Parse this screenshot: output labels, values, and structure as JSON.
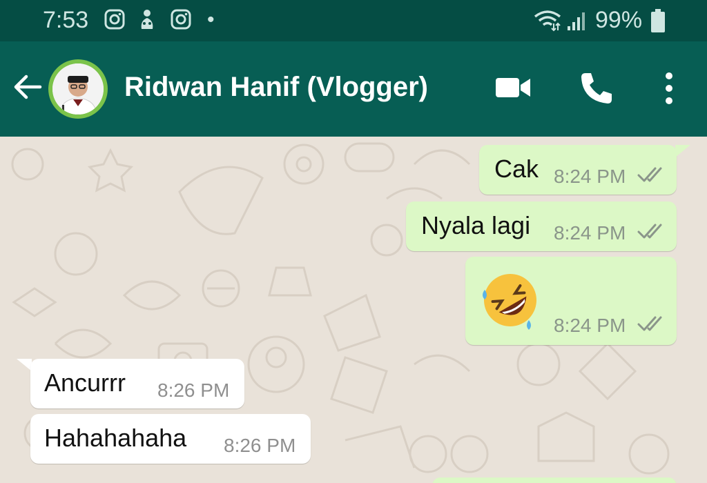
{
  "status_bar": {
    "time": "7:53",
    "battery": "99%",
    "icons": [
      "instagram-icon",
      "notification-icon",
      "instagram-icon",
      "dot",
      "wifi-icon",
      "signal-icon",
      "battery-icon"
    ]
  },
  "header": {
    "contact_name": "Ridwan Hanif (Vlogger)",
    "icons": [
      "back-arrow-icon",
      "avatar",
      "video-call-icon",
      "phone-icon",
      "more-vert-icon"
    ]
  },
  "colors": {
    "status_bar": "#054d44",
    "header": "#075e54",
    "outgoing_bubble": "#dcf8c6",
    "incoming_bubble": "#ffffff",
    "chat_background": "#e9e2d9"
  },
  "messages": [
    {
      "direction": "outgoing",
      "text": "Cak",
      "time": "8:24 PM",
      "status": "read-ticks"
    },
    {
      "direction": "outgoing",
      "text": "Nyala lagi",
      "time": "8:24 PM",
      "status": "read-ticks"
    },
    {
      "direction": "outgoing",
      "emoji": "rolling-on-floor-laughing",
      "time": "8:24 PM",
      "status": "read-ticks"
    },
    {
      "direction": "incoming",
      "text": "Ancurrr",
      "time": "8:26 PM"
    },
    {
      "direction": "incoming",
      "text": "Hahahahaha",
      "time": "8:26 PM"
    }
  ]
}
